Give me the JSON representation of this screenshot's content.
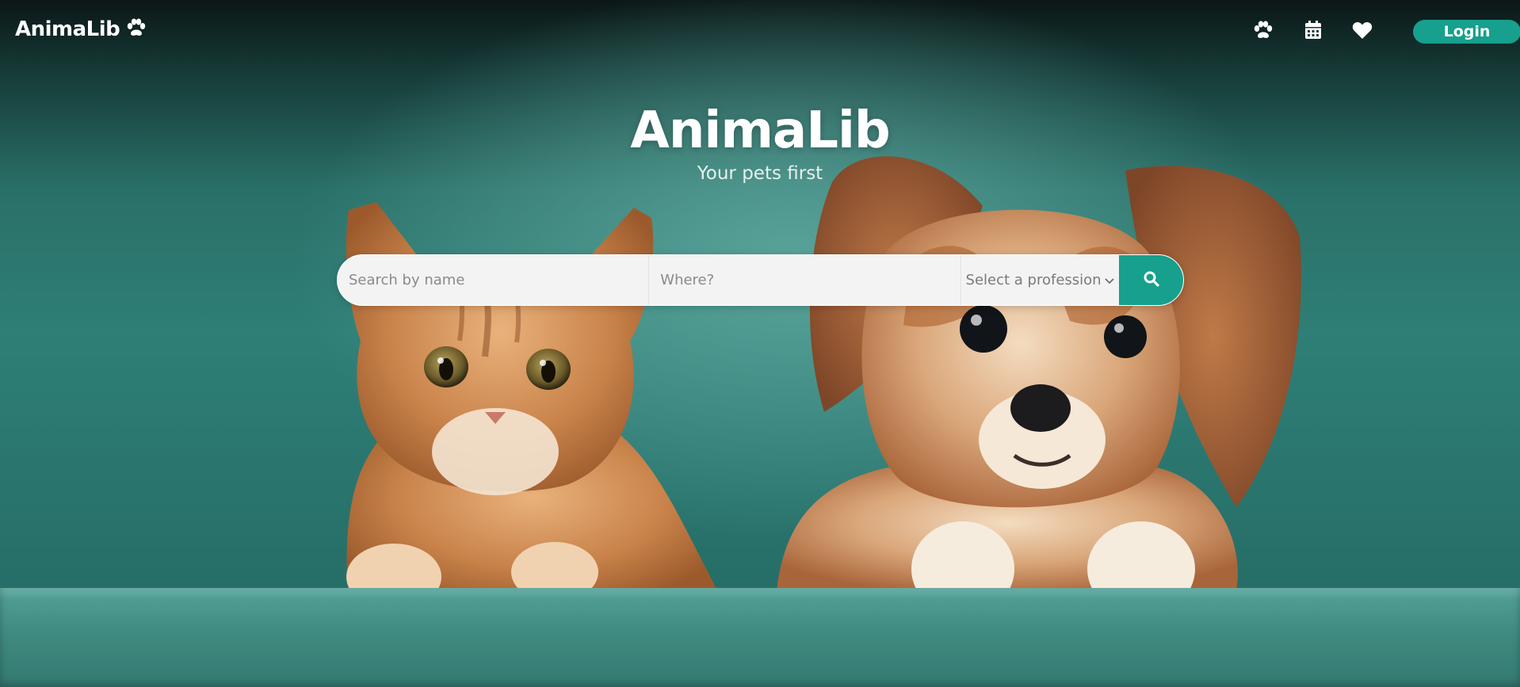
{
  "app": {
    "brand_name": "AnimaLib",
    "brand_icon": "paw-icon"
  },
  "nav": {
    "icons": [
      "paw-icon",
      "calendar-icon",
      "heart-icon"
    ],
    "login_label": "Login"
  },
  "hero": {
    "title": "AnimaLib",
    "subtitle": "Your pets first",
    "image_description_hidden": ""
  },
  "search": {
    "name_placeholder": "Search by name",
    "where_placeholder": "Where?",
    "profession_placeholder": "Select a profession",
    "submit_icon": "search-icon"
  },
  "colors": {
    "accent": "#16a08d",
    "text_light": "#ffffff",
    "search_bg": "#f3f3f3"
  }
}
